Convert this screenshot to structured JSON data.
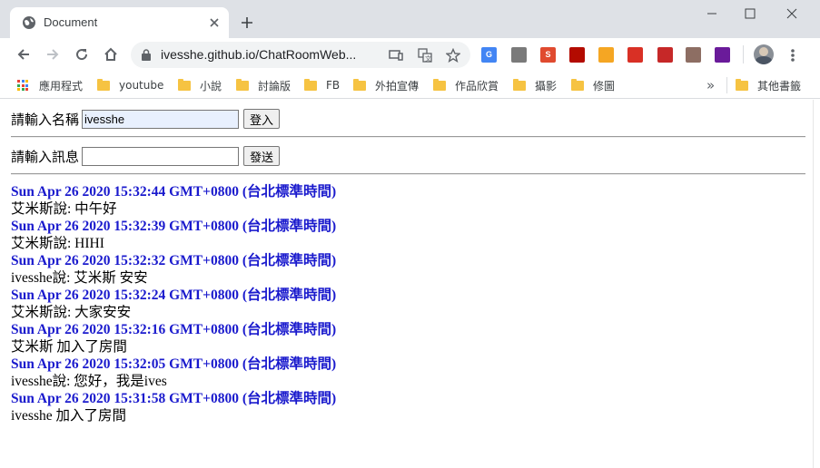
{
  "browser": {
    "tab_title": "Document",
    "url": "ivesshe.github.io/ChatRoomWeb...",
    "extensions": [
      {
        "name": "google-translate-icon",
        "color": "#4285f4",
        "label": "G"
      },
      {
        "name": "cast-icon",
        "color": "#7a7a7a",
        "label": ""
      },
      {
        "name": "slides-icon",
        "color": "#e04a2f",
        "label": "S"
      },
      {
        "name": "pdf-icon",
        "color": "#b30b00",
        "label": ""
      },
      {
        "name": "smart-pdf-icon",
        "color": "#f5a623",
        "label": ""
      },
      {
        "name": "pen-icon",
        "color": "#d93025",
        "label": ""
      },
      {
        "name": "calendar-icon",
        "color": "#c62828",
        "label": ""
      },
      {
        "name": "image-icon",
        "color": "#8d6e63",
        "label": ""
      },
      {
        "name": "download-icon",
        "color": "#6a1b9a",
        "label": ""
      }
    ]
  },
  "bookmarks": {
    "apps_label": "應用程式",
    "items": [
      "youtube",
      "小說",
      "討論版",
      "FB",
      "外拍宣傳",
      "作品欣賞",
      "攝影",
      "修圖"
    ],
    "overflow": "»",
    "other_label": "其他書籤"
  },
  "form": {
    "name_label": "請輸入名稱",
    "name_value": "ivesshe",
    "login_button": "登入",
    "message_label": "請輸入訊息",
    "message_value": "",
    "send_button": "發送"
  },
  "messages": [
    {
      "time": "Sun Apr 26 2020 15:32:44 GMT+0800 (台北標準時間)",
      "text": "艾米斯說: 中午好"
    },
    {
      "time": "Sun Apr 26 2020 15:32:39 GMT+0800 (台北標準時間)",
      "text": "艾米斯說: HIHI"
    },
    {
      "time": "Sun Apr 26 2020 15:32:32 GMT+0800 (台北標準時間)",
      "text": "ivesshe說: 艾米斯 安安"
    },
    {
      "time": "Sun Apr 26 2020 15:32:24 GMT+0800 (台北標準時間)",
      "text": "艾米斯說: 大家安安"
    },
    {
      "time": "Sun Apr 26 2020 15:32:16 GMT+0800 (台北標準時間)",
      "text": "艾米斯 加入了房間"
    },
    {
      "time": "Sun Apr 26 2020 15:32:05 GMT+0800 (台北標準時間)",
      "text": "ivesshe說: 您好，我是ives"
    },
    {
      "time": "Sun Apr 26 2020 15:31:58 GMT+0800 (台北標準時間)",
      "text": "ivesshe 加入了房間"
    }
  ]
}
